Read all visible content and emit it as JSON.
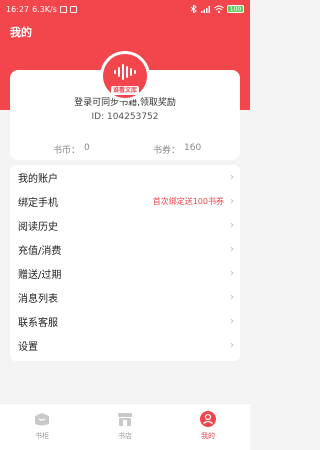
{
  "status_bar": {
    "time": "16:27",
    "speed": "6.3K/s",
    "battery": "100"
  },
  "header": {
    "title": "我的"
  },
  "profile": {
    "logo_text": "谁看文库",
    "login_prompt": "登录可同步书籍,领取奖励",
    "id_label": "ID: 104253752"
  },
  "stats": {
    "coin_label": "书币：",
    "coin_value": "0",
    "voucher_label": "书券：",
    "voucher_value": "160"
  },
  "menu": {
    "items": [
      {
        "label": "我的账户",
        "note": ""
      },
      {
        "label": "绑定手机",
        "note": "首次绑定送100书券"
      },
      {
        "label": "阅读历史",
        "note": ""
      },
      {
        "label": "充值/消费",
        "note": ""
      },
      {
        "label": "赠送/过期",
        "note": ""
      },
      {
        "label": "消息列表",
        "note": ""
      },
      {
        "label": "联系客服",
        "note": ""
      },
      {
        "label": "设置",
        "note": ""
      }
    ]
  },
  "tabbar": {
    "tabs": [
      {
        "label": "书柜",
        "icon": "bookshelf-icon"
      },
      {
        "label": "书店",
        "icon": "bookstore-icon"
      },
      {
        "label": "我的",
        "icon": "profile-icon",
        "active": true
      }
    ]
  },
  "colors": {
    "accent": "#f2454c",
    "background": "#f4f4f4"
  }
}
